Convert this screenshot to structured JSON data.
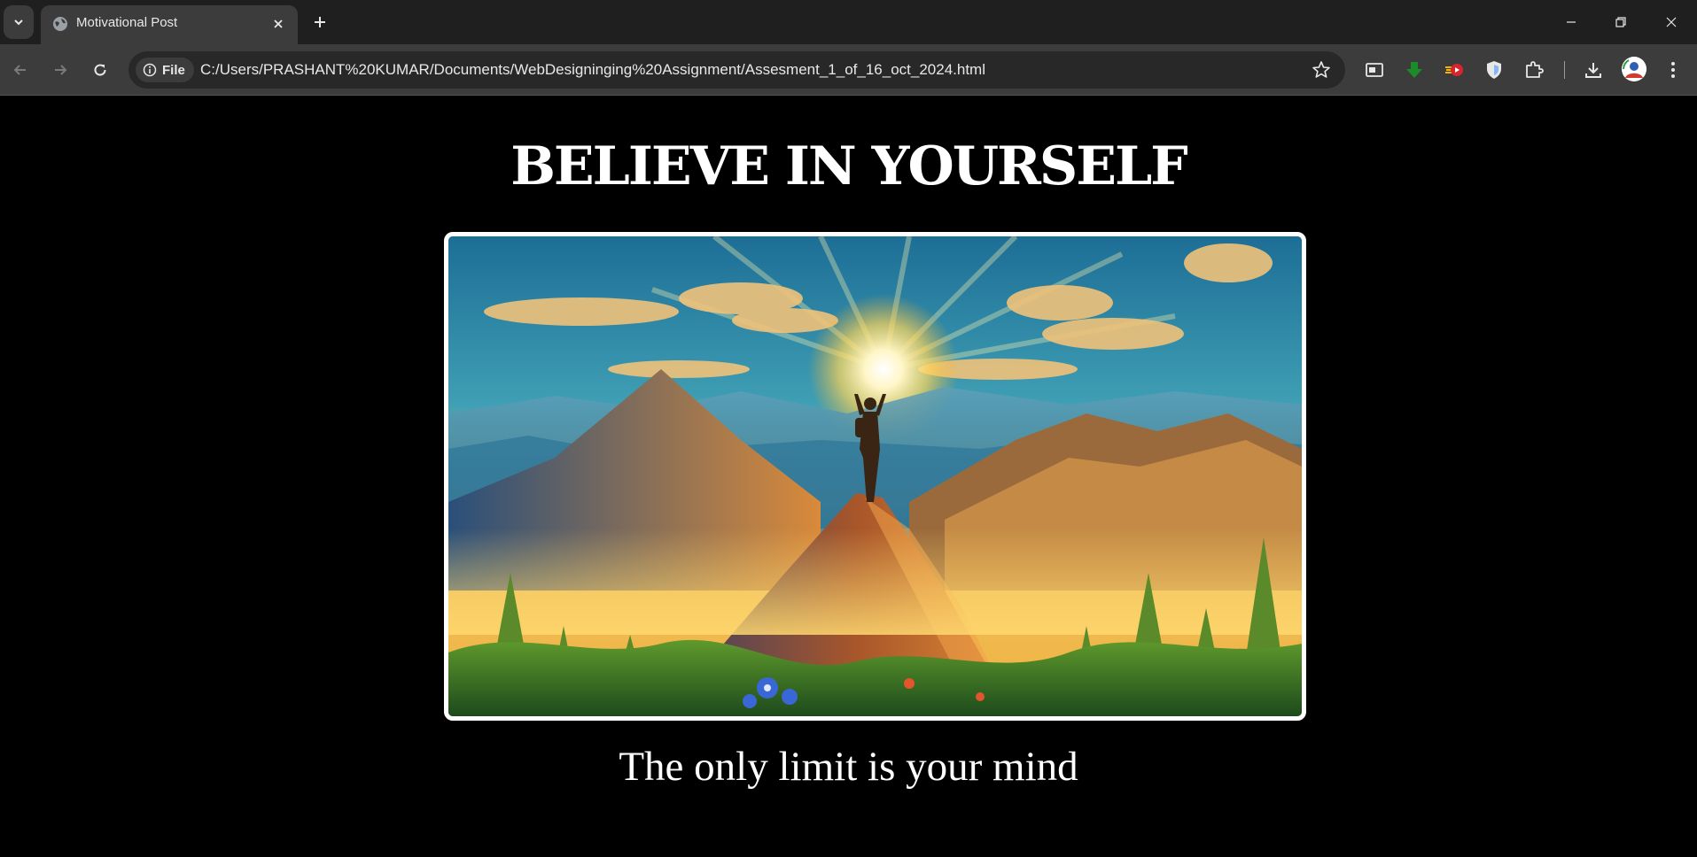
{
  "browser": {
    "tab": {
      "title": "Motivational Post"
    },
    "address": {
      "chip_label": "File",
      "url": "C:/Users/PRASHANT%20KUMAR/Documents/WebDesigninging%20Assignment/Assesment_1_of_16_oct_2024.html"
    },
    "icons": [
      "tab-search-icon",
      "globe-icon",
      "close-icon",
      "plus-icon",
      "minimize-icon",
      "restore-icon",
      "window-close-icon",
      "back-icon",
      "forward-icon",
      "reload-icon",
      "info-icon",
      "star-icon",
      "picture-in-picture-icon",
      "download-arrow-extension-icon",
      "video-extension-icon",
      "shield-extension-icon",
      "puzzle-icon",
      "download-icon",
      "profile-avatar",
      "more-menu-icon"
    ]
  },
  "page": {
    "headline": "BELIEVE IN YOURSELF",
    "image_description": "A hiker with raised arms on a mountain summit at sunrise, surrounded by pine trees and flowers",
    "tagline": "The only limit is your mind"
  },
  "colors": {
    "page_background": "#000000",
    "text": "#ffffff",
    "tabstrip": "#1f1f1f",
    "toolbar": "#3c3c3c",
    "omnibox": "#282828"
  }
}
